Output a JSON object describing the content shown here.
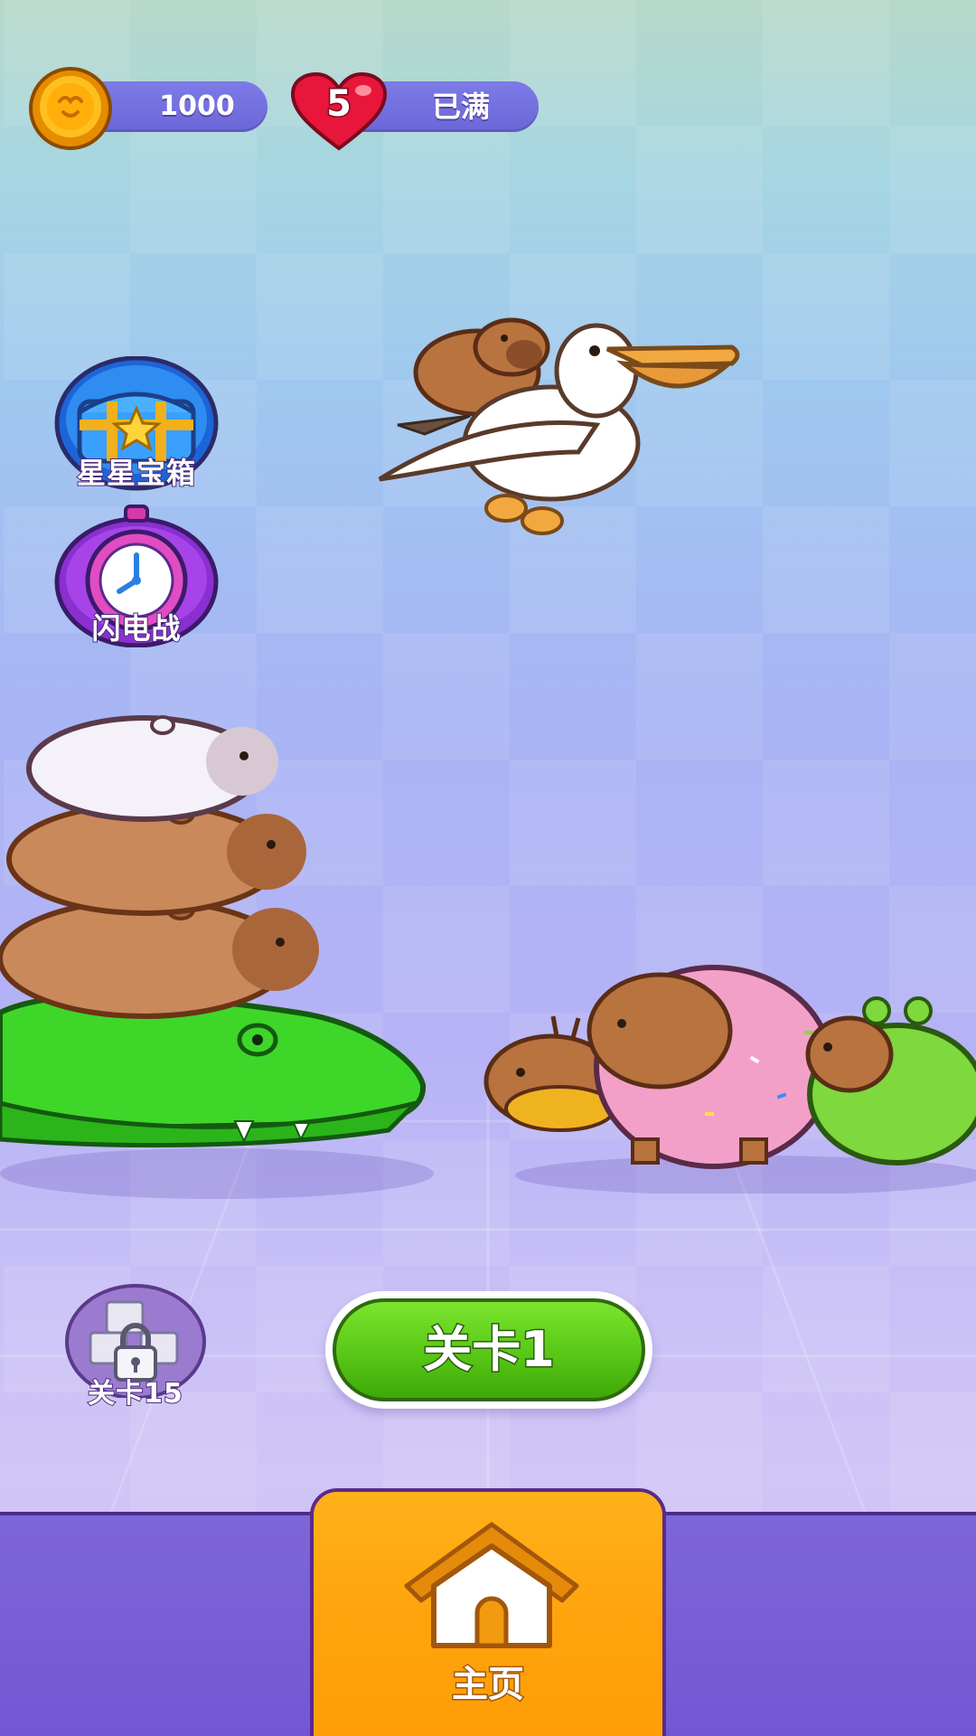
{
  "hud": {
    "coins": "1000",
    "lives_count": "5",
    "lives_status": "已满"
  },
  "side_buttons": {
    "star_chest_label": "星星宝箱",
    "lightning_battle_label": "闪电战",
    "locked_level_label": "关卡15"
  },
  "play": {
    "label": "关卡1"
  },
  "nav": {
    "home_label": "主页"
  },
  "colors": {
    "play_green": "#55c414",
    "home_orange": "#ffa30d",
    "nav_purple": "#7356d4",
    "pill_purple": "#6b67d9"
  },
  "icons": [
    "coin-icon",
    "heart-icon",
    "treasure-chest-icon",
    "stopwatch-icon",
    "lock-icon",
    "home-icon"
  ]
}
